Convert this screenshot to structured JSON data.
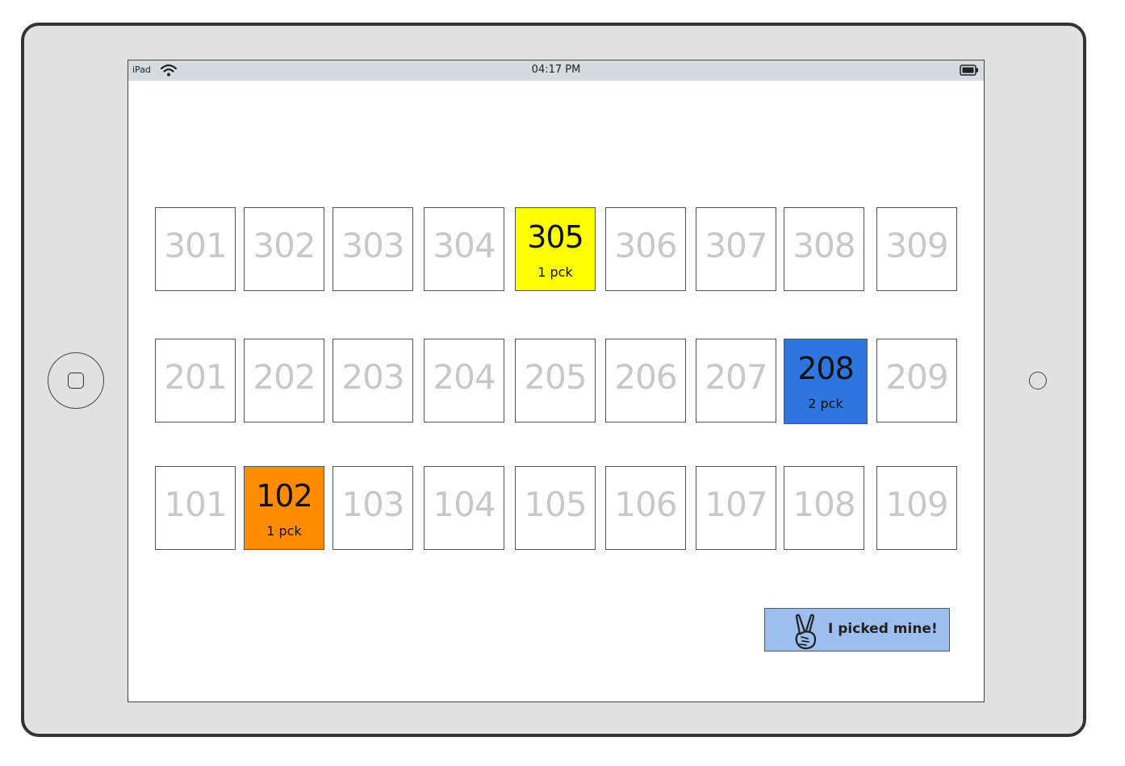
{
  "status_bar": {
    "carrier": "iPad",
    "time": "04:17 PM"
  },
  "rows": [
    {
      "cells": [
        {
          "number": "301",
          "sub": ""
        },
        {
          "number": "302",
          "sub": ""
        },
        {
          "number": "303",
          "sub": ""
        },
        {
          "number": "304",
          "sub": ""
        },
        {
          "number": "305",
          "sub": "1 pck",
          "color": "#ffff00"
        },
        {
          "number": "306",
          "sub": ""
        },
        {
          "number": "307",
          "sub": ""
        },
        {
          "number": "308",
          "sub": ""
        },
        {
          "number": "309",
          "sub": ""
        }
      ]
    },
    {
      "cells": [
        {
          "number": "201",
          "sub": ""
        },
        {
          "number": "202",
          "sub": ""
        },
        {
          "number": "203",
          "sub": ""
        },
        {
          "number": "204",
          "sub": ""
        },
        {
          "number": "205",
          "sub": ""
        },
        {
          "number": "206",
          "sub": ""
        },
        {
          "number": "207",
          "sub": ""
        },
        {
          "number": "208",
          "sub": "2 pck",
          "color": "#2f75de"
        },
        {
          "number": "209",
          "sub": ""
        }
      ]
    },
    {
      "cells": [
        {
          "number": "101",
          "sub": ""
        },
        {
          "number": "102",
          "sub": "1 pck",
          "color": "#ff8c00"
        },
        {
          "number": "103",
          "sub": ""
        },
        {
          "number": "104",
          "sub": ""
        },
        {
          "number": "105",
          "sub": ""
        },
        {
          "number": "106",
          "sub": ""
        },
        {
          "number": "107",
          "sub": ""
        },
        {
          "number": "108",
          "sub": ""
        },
        {
          "number": "109",
          "sub": ""
        }
      ]
    }
  ],
  "pick_button": {
    "label": "I picked mine!",
    "icon": "peace-hand-icon",
    "color": "#9dbfef"
  }
}
